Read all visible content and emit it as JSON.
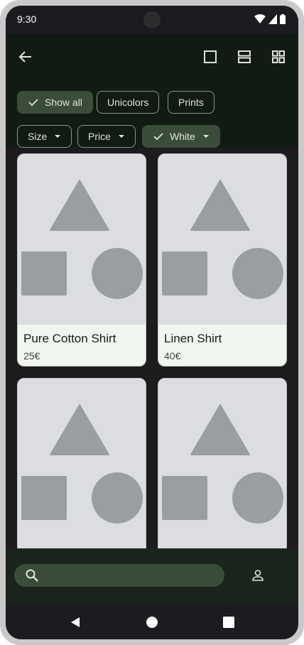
{
  "status_bar": {
    "time": "9:30"
  },
  "filters": {
    "row1": [
      {
        "label": "Show all",
        "selected": true
      },
      {
        "label": "Unicolors",
        "selected": false
      },
      {
        "label": "Prints",
        "selected": false
      }
    ],
    "row2": [
      {
        "label": "Size",
        "selected": false
      },
      {
        "label": "Price",
        "selected": false
      },
      {
        "label": "White",
        "selected": true
      }
    ]
  },
  "products": [
    {
      "name": "Pure Cotton Shirt",
      "price": "25€"
    },
    {
      "name": "Linen Shirt",
      "price": "40€"
    },
    {
      "name": "",
      "price": ""
    },
    {
      "name": "",
      "price": ""
    }
  ],
  "icons": {
    "back": "arrow-back-icon",
    "view_single": "view-single-icon",
    "view_list": "view-list-icon",
    "view_grid": "view-grid-icon",
    "search": "search-icon",
    "account": "account-icon"
  },
  "colors": {
    "topbar_bg": "#121b13",
    "chip_selected": "#3a4c3a",
    "card_info_bg": "#f1f7ee",
    "placeholder_shape": "#9a9da1"
  }
}
